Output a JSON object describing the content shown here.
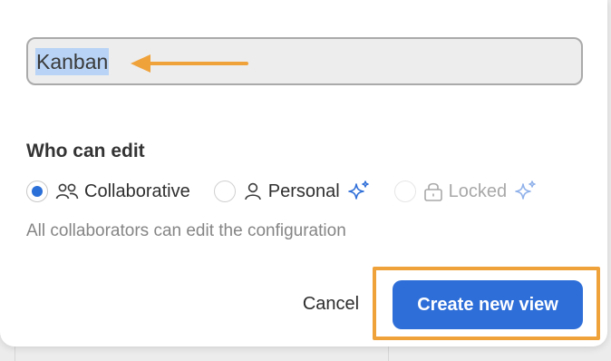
{
  "view_name": {
    "value": "Kanban"
  },
  "permissions": {
    "title": "Who can edit",
    "options": [
      {
        "label": "Collaborative",
        "icon": "people-icon",
        "selected": true,
        "disabled": false,
        "premium": false
      },
      {
        "label": "Personal",
        "icon": "person-icon",
        "selected": false,
        "disabled": false,
        "premium": true
      },
      {
        "label": "Locked",
        "icon": "lock-icon",
        "selected": false,
        "disabled": true,
        "premium": true
      }
    ],
    "hint": "All collaborators can edit the configuration"
  },
  "actions": {
    "cancel_label": "Cancel",
    "create_label": "Create new view"
  },
  "colors": {
    "accent": "#2e6ed8",
    "annotation": "#f0a23a",
    "selection": "#b8d3f5"
  }
}
